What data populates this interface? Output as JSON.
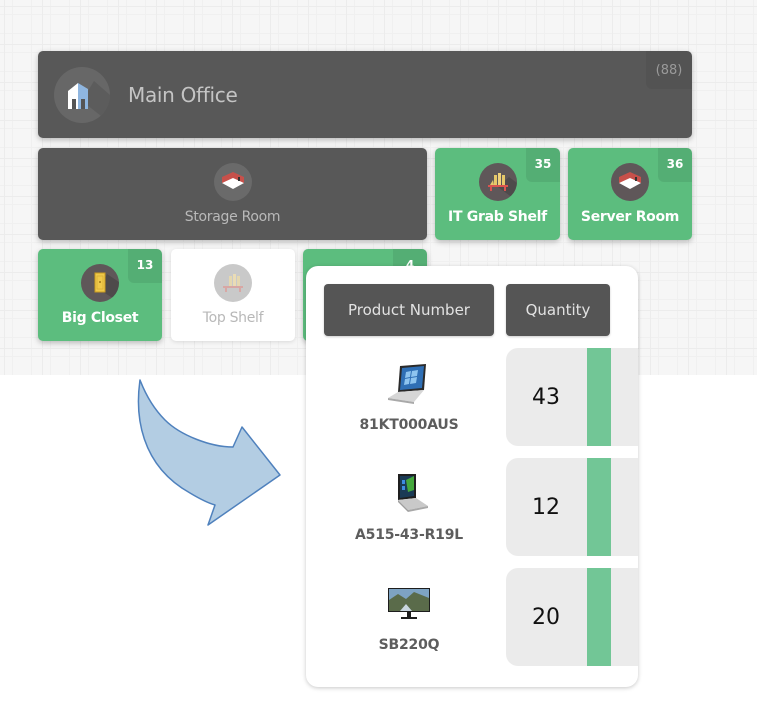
{
  "locations": {
    "main_office": {
      "label": "Main Office",
      "count": "(88)",
      "icon": "building-icon"
    },
    "storage_room": {
      "label": "Storage Room",
      "icon": "room-icon"
    },
    "it_grab_shelf": {
      "label": "IT Grab Shelf",
      "count": "35",
      "icon": "shelf-icon"
    },
    "server_room": {
      "label": "Server Room",
      "count": "36",
      "icon": "room-icon"
    },
    "big_closet": {
      "label": "Big Closet",
      "count": "13",
      "icon": "door-icon"
    },
    "top_shelf": {
      "label": "Top Shelf",
      "icon": "shelf-icon"
    },
    "hidden_tile": {
      "count": "4"
    }
  },
  "colors": {
    "dark_tile": "#585858",
    "green_tile": "#5cbd7e",
    "quantity_bar": "#72c696",
    "arrow_fill": "#b3cde3",
    "arrow_stroke": "#4f81bd"
  },
  "product_panel": {
    "headers": {
      "product_number": "Product Number",
      "quantity": "Quantity"
    },
    "rows": [
      {
        "product_number": "81KT000AUS",
        "quantity": "43",
        "image": "laptop-icon"
      },
      {
        "product_number": "A515-43-R19L",
        "quantity": "12",
        "image": "laptop-icon"
      },
      {
        "product_number": "SB220Q",
        "quantity": "20",
        "image": "monitor-icon"
      }
    ]
  }
}
